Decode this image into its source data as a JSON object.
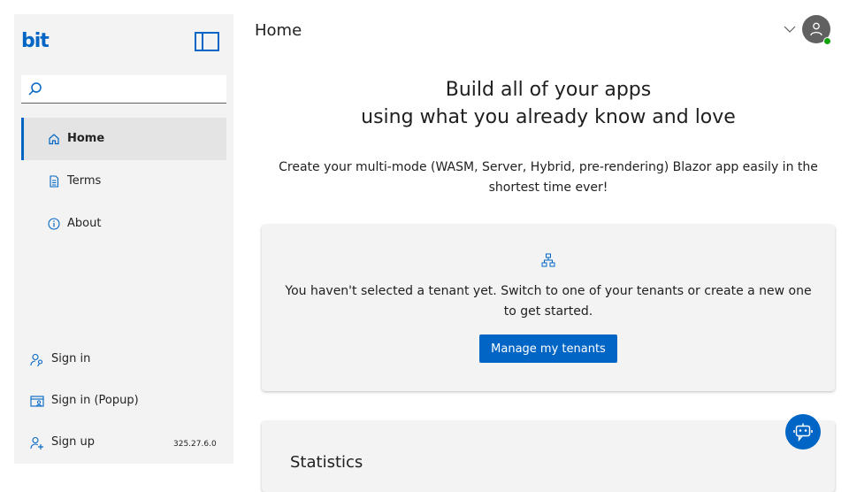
{
  "app": {
    "logo_text": "bit"
  },
  "search": {
    "placeholder": "",
    "value": ""
  },
  "nav": [
    {
      "label": "Home",
      "icon": "home-icon",
      "active": true
    },
    {
      "label": "Terms",
      "icon": "document-icon",
      "active": false
    },
    {
      "label": "About",
      "icon": "info-icon",
      "active": false
    }
  ],
  "auth": [
    {
      "label": "Sign in",
      "icon": "person-key-icon"
    },
    {
      "label": "Sign in (Popup)",
      "icon": "window-person-icon"
    },
    {
      "label": "Sign up",
      "icon": "person-add-icon"
    }
  ],
  "version": "325.27.6.0",
  "header": {
    "title": "Home"
  },
  "hero": {
    "line1": "Build all of your apps",
    "line2": "using what you already know and love",
    "subtitle": "Create your multi-mode (WASM, Server, Hybrid, pre-rendering) Blazor app easily in the shortest time ever!"
  },
  "tenant_card": {
    "message": "You haven't selected a tenant yet. Switch to one of your tenants or create a new one to get started.",
    "button_label": "Manage my tenants"
  },
  "statistics": {
    "title": "Statistics"
  },
  "colors": {
    "accent": "#0065c4",
    "sidebar_bg": "#f3f3f3",
    "presence": "#13a10e"
  }
}
